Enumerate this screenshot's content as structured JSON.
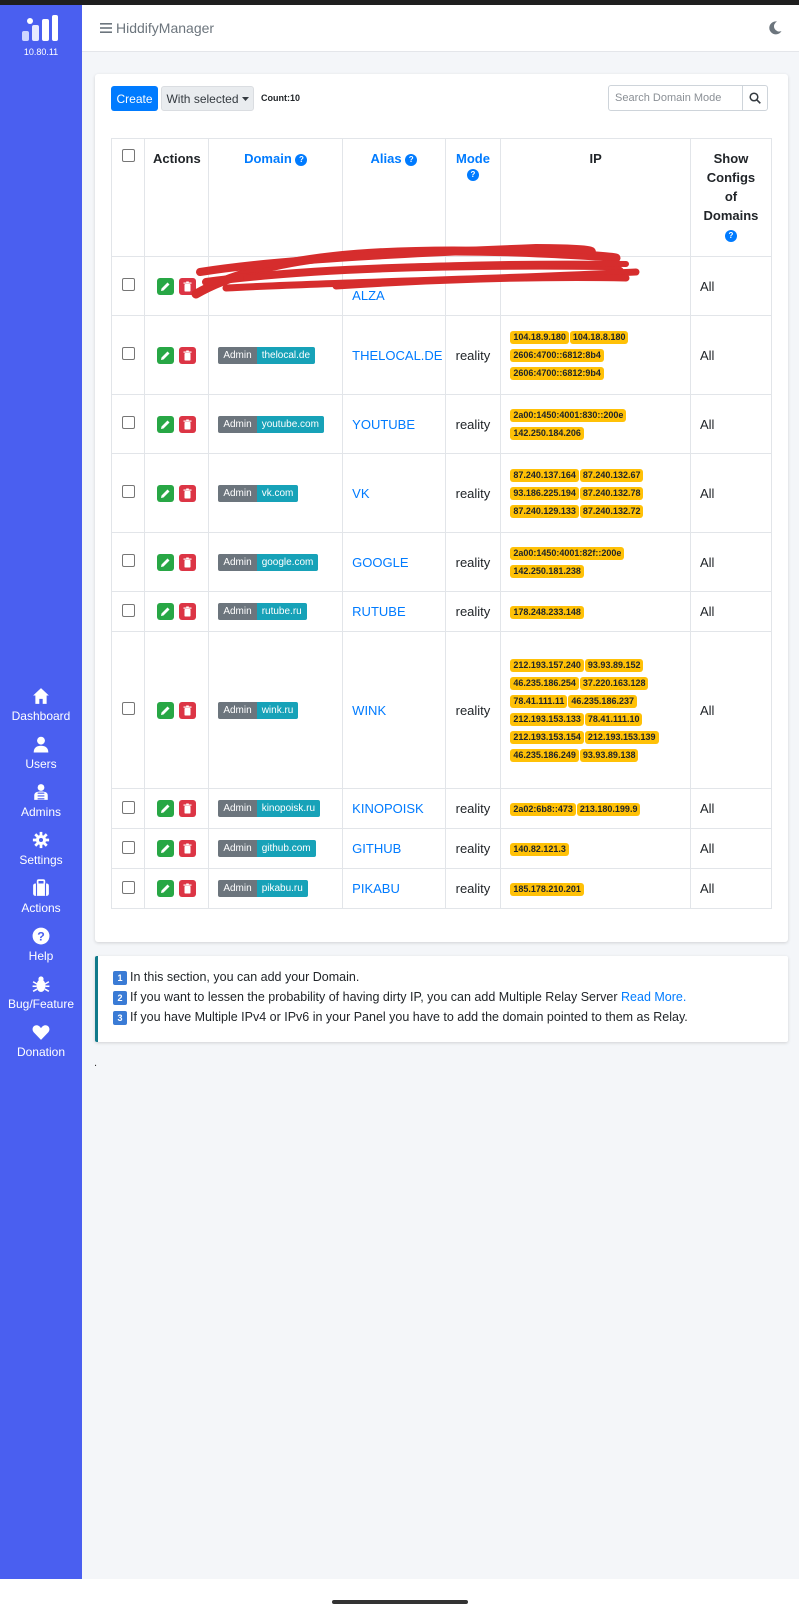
{
  "app": {
    "title": "HiddifyManager",
    "version": "10.80.11"
  },
  "sidebar": {
    "items": [
      {
        "label": "Dashboard",
        "icon": "home-icon"
      },
      {
        "label": "Users",
        "icon": "user-icon"
      },
      {
        "label": "Admins",
        "icon": "admin-icon"
      },
      {
        "label": "Settings",
        "icon": "gear-icon"
      },
      {
        "label": "Actions",
        "icon": "briefcase-icon"
      },
      {
        "label": "Help",
        "icon": "question-icon"
      },
      {
        "label": "Bug/Feature",
        "icon": "bug-icon"
      },
      {
        "label": "Donation",
        "icon": "heart-icon"
      }
    ]
  },
  "toolbar": {
    "create_label": "Create",
    "with_selected_label": "With selected",
    "count_label": "Count:10",
    "search_placeholder": "Search Domain Mode"
  },
  "table": {
    "headers": {
      "actions": "Actions",
      "domain": "Domain",
      "alias": "Alias",
      "mode": "Mode",
      "ip": "IP",
      "show_configs": "Show Configs of Domains"
    },
    "rows": [
      {
        "owner": "Admin",
        "domain": "",
        "alias": "ALZA",
        "mode": "",
        "ips": [],
        "show": "All",
        "redacted": true
      },
      {
        "owner": "Admin",
        "domain": "thelocal.de",
        "alias": "THELOCAL.DE",
        "mode": "reality",
        "ips": [
          "104.18.9.180",
          "104.18.8.180",
          "2606:4700::6812:8b4",
          "2606:4700::6812:9b4"
        ],
        "show": "All"
      },
      {
        "owner": "Admin",
        "domain": "youtube.com",
        "alias": "YOUTUBE",
        "mode": "reality",
        "ips": [
          "2a00:1450:4001:830::200e",
          "142.250.184.206"
        ],
        "show": "All"
      },
      {
        "owner": "Admin",
        "domain": "vk.com",
        "alias": "VK",
        "mode": "reality",
        "ips": [
          "87.240.137.164",
          "87.240.132.67",
          "93.186.225.194",
          "87.240.132.78",
          "87.240.129.133",
          "87.240.132.72"
        ],
        "show": "All"
      },
      {
        "owner": "Admin",
        "domain": "google.com",
        "alias": "GOOGLE",
        "mode": "reality",
        "ips": [
          "2a00:1450:4001:82f::200e",
          "142.250.181.238"
        ],
        "show": "All"
      },
      {
        "owner": "Admin",
        "domain": "rutube.ru",
        "alias": "RUTUBE",
        "mode": "reality",
        "ips": [
          "178.248.233.148"
        ],
        "show": "All"
      },
      {
        "owner": "Admin",
        "domain": "wink.ru",
        "alias": "WINK",
        "mode": "reality",
        "ips": [
          "212.193.157.240",
          "93.93.89.152",
          "46.235.186.254",
          "37.220.163.128",
          "78.41.111.11",
          "46.235.186.237",
          "212.193.153.133",
          "78.41.111.10",
          "212.193.153.154",
          "212.193.153.139",
          "46.235.186.249",
          "93.93.89.138"
        ],
        "show": "All"
      },
      {
        "owner": "Admin",
        "domain": "kinopoisk.ru",
        "alias": "KINOPOISK",
        "mode": "reality",
        "ips": [
          "2a02:6b8::473",
          "213.180.199.9"
        ],
        "show": "All"
      },
      {
        "owner": "Admin",
        "domain": "github.com",
        "alias": "GITHUB",
        "mode": "reality",
        "ips": [
          "140.82.121.3"
        ],
        "show": "All"
      },
      {
        "owner": "Admin",
        "domain": "pikabu.ru",
        "alias": "PIKABU",
        "mode": "reality",
        "ips": [
          "185.178.210.201"
        ],
        "show": "All"
      }
    ]
  },
  "info": {
    "line1": "In this section, you can add your Domain.",
    "line2": "If you want to lessen the probability of having dirty IP, you can add Multiple Relay Server",
    "line2_link": "Read More.",
    "line3": "If you have Multiple IPv4 or IPv6 in your Panel you have to add the domain pointed to them as Relay.",
    "markers": [
      "1",
      "2",
      "3"
    ]
  },
  "colors": {
    "sidebar": "#4a5ff0",
    "primary": "#007bff",
    "success": "#28a745",
    "danger": "#dc3545",
    "info": "#17a2b8",
    "warning": "#ffc107",
    "secondary": "#6c757d"
  }
}
